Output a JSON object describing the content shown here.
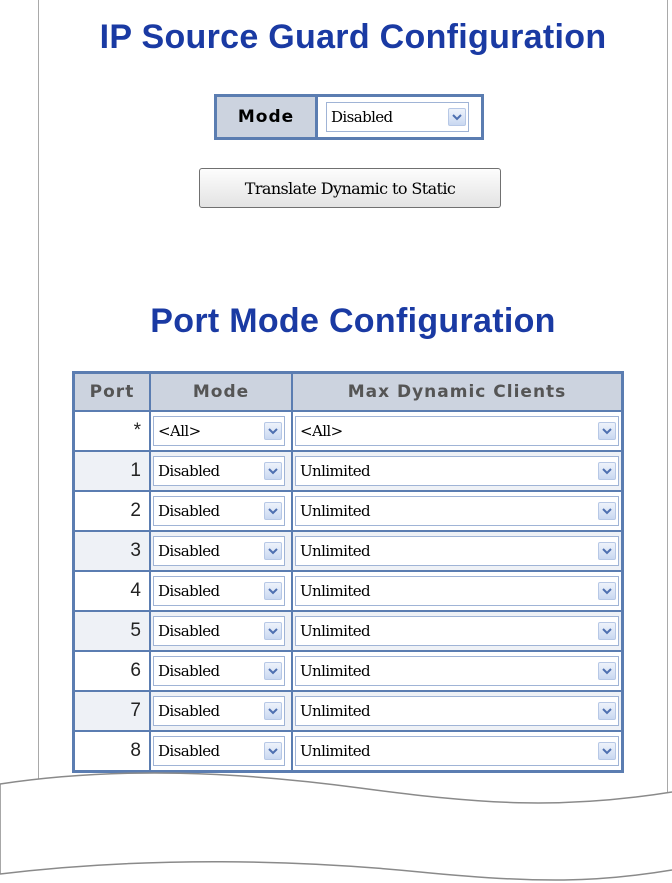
{
  "page": {
    "title": "IP Source Guard Configuration",
    "section_title": "Port Mode Configuration"
  },
  "global_mode": {
    "label": "Mode",
    "value": "Disabled"
  },
  "translate_button": {
    "label": "Translate Dynamic to Static"
  },
  "table": {
    "headers": {
      "port": "Port",
      "mode": "Mode",
      "max_clients": "Max Dynamic Clients"
    },
    "rows": [
      {
        "port": "*",
        "mode": "<All>",
        "max_clients": "<All>"
      },
      {
        "port": "1",
        "mode": "Disabled",
        "max_clients": "Unlimited"
      },
      {
        "port": "2",
        "mode": "Disabled",
        "max_clients": "Unlimited"
      },
      {
        "port": "3",
        "mode": "Disabled",
        "max_clients": "Unlimited"
      },
      {
        "port": "4",
        "mode": "Disabled",
        "max_clients": "Unlimited"
      },
      {
        "port": "5",
        "mode": "Disabled",
        "max_clients": "Unlimited"
      },
      {
        "port": "6",
        "mode": "Disabled",
        "max_clients": "Unlimited"
      },
      {
        "port": "7",
        "mode": "Disabled",
        "max_clients": "Unlimited"
      },
      {
        "port": "8",
        "mode": "Disabled",
        "max_clients": "Unlimited"
      }
    ]
  },
  "colors": {
    "title": "#1a3aa3",
    "table_border": "#5b7db1",
    "header_bg": "#ccd3df",
    "alt_row_bg": "#eef1f6"
  },
  "icons": {
    "dropdown": "chevron-down-icon"
  }
}
